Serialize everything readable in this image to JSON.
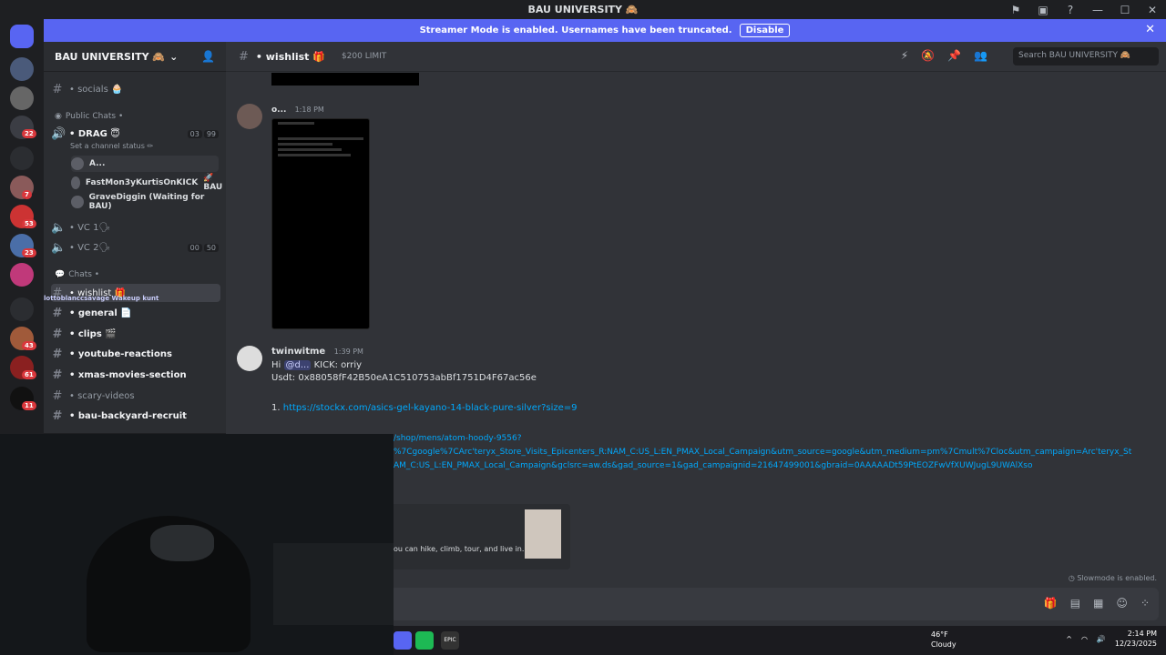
{
  "window": {
    "title": "BAU UNIVERSITY 🙈"
  },
  "banner": {
    "text": "Streamer Mode is enabled. Usernames have been truncated.",
    "button": "Disable"
  },
  "server": {
    "name": "BAU UNIVERSITY 🙈"
  },
  "sidebar": {
    "socials": "• socials 🧁",
    "public_chats": "Public Chats •",
    "drag": "• DRAG 😇",
    "drag_counts": [
      "03",
      "99"
    ],
    "drag_status": "Set a channel status ✏",
    "voice_users": [
      "A...",
      "FastMon3yKurtisOnKICK",
      "GraveDiggin (Waiting for BAU)"
    ],
    "voice_user_tag": "🚀 BAU",
    "vc1": "• VC 1🗣",
    "vc2": "• VC 2🗣",
    "vc2_counts": [
      "00",
      "50"
    ],
    "chats_cat": "Chats •",
    "channels": [
      "• wishlist 🎁",
      "• general 📄",
      "• clips 🎬",
      "• youtube-reactions",
      "• xmas-movies-section",
      "• scary-videos",
      "• bau-backyard-recruit"
    ],
    "typing": "lottoblanccsavage  Wakeup kunt"
  },
  "header": {
    "channel": "• wishlist 🎁",
    "topic": "$200 LIMIT",
    "search_placeholder": "Search BAU UNIVERSITY 🙈"
  },
  "messages": [
    {
      "user": "o...",
      "time": "1:18 PM"
    },
    {
      "user": "twinwitme",
      "time": "1:39 PM",
      "line1_prefix": "Hi",
      "mention": "@d...",
      "line1_suffix": "KICK: orriy",
      "line2": "Usdt: 0x88058fF42B50eA1C510753abBf1751D4F67ac56e",
      "list_num": "1.",
      "link1": "https://stockx.com/asics-gel-kayano-14-black-pure-silver?size=9",
      "link2a": "/shop/mens/atom-hoody-9556?",
      "link2b": "%7Cgoogle%7CArc'teryx_Store_Visits_Epicenters_R:NAM_C:US_L:EN_PMAX_Local_Campaign&utm_source=google&utm_medium=pm%7Cmult%7Cloc&utm_campaign=Arc'teryx_St",
      "link2c": "AM_C:US_L:EN_PMAX_Local_Campaign&gclsrc=aw.ds&gad_source=1&gad_campaignid=21647499001&gbraid=0AAAAADt59PtEOZFwVfXUWJugL9UWAlXso",
      "embed_text": "ou can hike, climb, tour, and live in."
    }
  ],
  "slowmode": "Slowmode is enabled.",
  "taskbar": {
    "temp": "46°F",
    "weather": "Cloudy",
    "time": "2:14 PM",
    "date": "12/23/2025"
  },
  "badges": [
    "22",
    "7",
    "53",
    "23",
    "43",
    "61",
    "11"
  ]
}
